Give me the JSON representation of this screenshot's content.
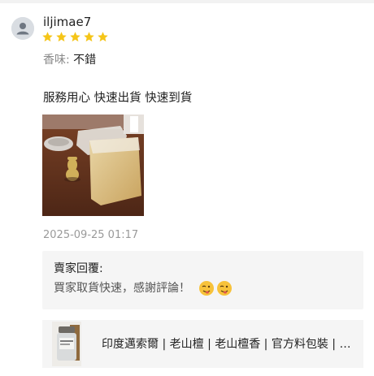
{
  "review": {
    "username": "iljimae7",
    "rating": 5,
    "attribute": {
      "label": "香味: ",
      "value": "不錯"
    },
    "comment": "服務用心 快速出貨 快速到貨",
    "timestamp": "2025-09-25 01:17"
  },
  "seller_reply": {
    "title": "賣家回覆:",
    "text": "買家取貨快速，感謝評論！",
    "emoji_icons": [
      "wink-tongue-emoji-icon",
      "wink-tongue-emoji-icon"
    ]
  },
  "product": {
    "title": "印度邁索爾 | 老山檀 | 老山檀香 | 官方料包裝 | 檀香粉"
  },
  "colors": {
    "star": "#f5c518",
    "reply_bg": "#f5f5f5",
    "muted_text": "#9a9a9a"
  }
}
